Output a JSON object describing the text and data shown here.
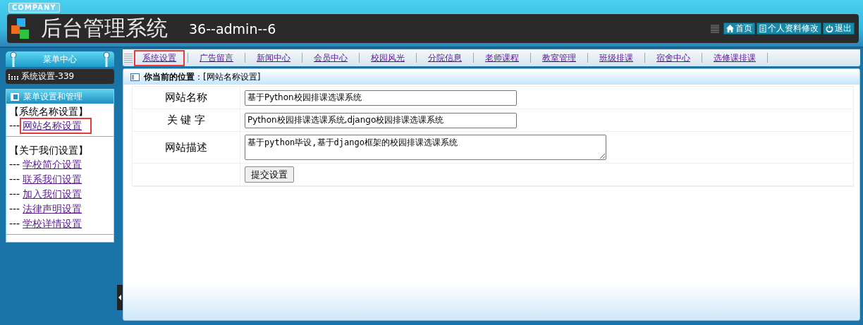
{
  "header": {
    "badge": "COMPANY",
    "title": "后台管理系统",
    "user": "36--admin--6",
    "buttons": [
      {
        "kind": "home",
        "label": "首页"
      },
      {
        "kind": "profile",
        "label": "个人资料修改"
      },
      {
        "kind": "logout",
        "label": "退出"
      }
    ]
  },
  "sidebar": {
    "title": "菜单中心",
    "module": "系统设置-339",
    "panel_title": "菜单设置和管理",
    "groups": [
      {
        "heading": "【系统名称设置】",
        "items": [
          {
            "prefix": "---",
            "label": "网站名称设置",
            "selected": true
          }
        ]
      },
      {
        "heading": "【关于我们设置】",
        "items": [
          {
            "prefix": "---",
            "label": "学校简介设置",
            "selected": false
          },
          {
            "prefix": "---",
            "label": "联系我们设置",
            "selected": false
          },
          {
            "prefix": "---",
            "label": "加入我们设置",
            "selected": false
          },
          {
            "prefix": "---",
            "label": "法律声明设置",
            "selected": false
          },
          {
            "prefix": "---",
            "label": "学校详情设置",
            "selected": false
          }
        ]
      }
    ]
  },
  "nav": {
    "tabs": [
      {
        "label": "系统设置",
        "selected": true
      },
      {
        "label": "广告留言",
        "selected": false
      },
      {
        "label": "新闻中心",
        "selected": false
      },
      {
        "label": "会员中心",
        "selected": false
      },
      {
        "label": "校园风光",
        "selected": false
      },
      {
        "label": "分院信息",
        "selected": false
      },
      {
        "label": "老师课程",
        "selected": false
      },
      {
        "label": "教室管理",
        "selected": false
      },
      {
        "label": "班级排课",
        "selected": false
      },
      {
        "label": "宿舍中心",
        "selected": false
      },
      {
        "label": "选修课排课",
        "selected": false
      }
    ]
  },
  "breadcrumb": "**你当前的位置**：[网站名称设置]",
  "form": {
    "fields": [
      {
        "kind": "input",
        "label": "网站名称",
        "value": "基于Python校园排课选课系统"
      },
      {
        "kind": "input",
        "label": "关 键 字",
        "value": "Python校园排课选课系统,django校园排课选课系统"
      },
      {
        "kind": "textarea",
        "label": "网站描述",
        "value": "基于python毕设,基于django框架的校园排课选课系统"
      }
    ],
    "submit": "提交设置"
  }
}
